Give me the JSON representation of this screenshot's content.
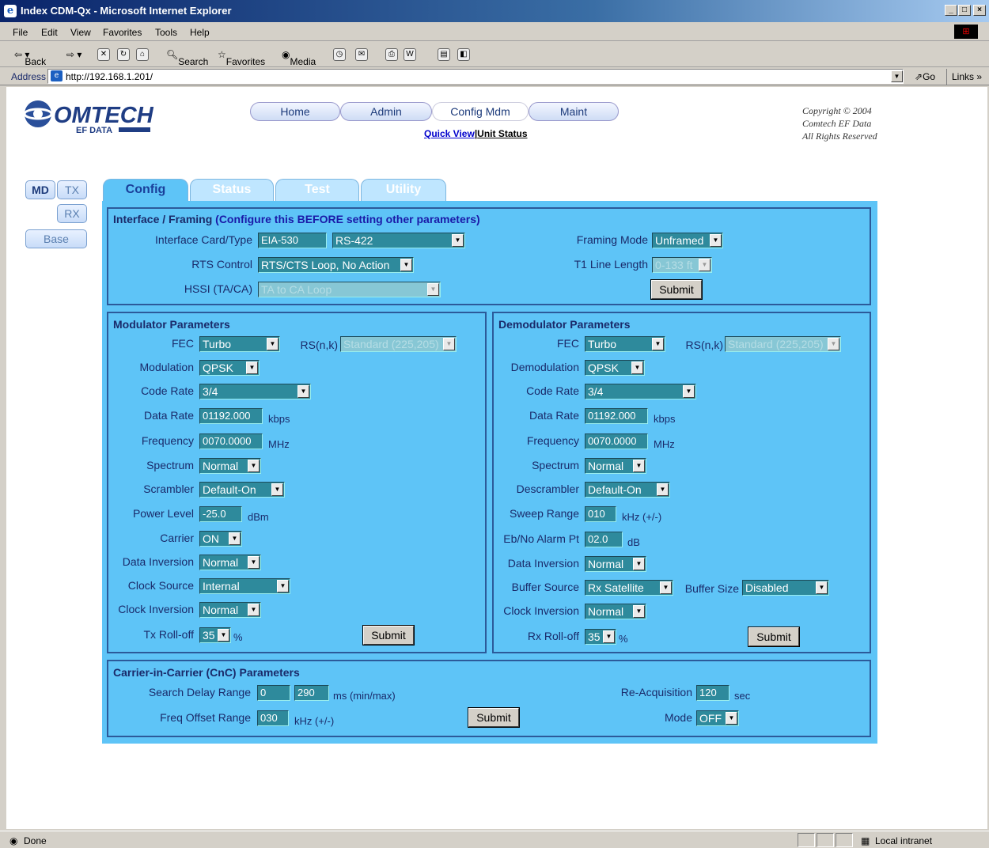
{
  "window": {
    "title": "Index CDM-Qx - Microsoft Internet Explorer"
  },
  "menu": [
    "File",
    "Edit",
    "View",
    "Favorites",
    "Tools",
    "Help"
  ],
  "toolbar": {
    "back": "Back",
    "search": "Search",
    "favorites": "Favorites",
    "media": "Media"
  },
  "address": {
    "label": "Address",
    "url": "http://192.168.1.201/",
    "go": "Go",
    "links": "Links »"
  },
  "header": {
    "nav": [
      "Home",
      "Admin",
      "Config Mdm",
      "Maint"
    ],
    "quick_view": "Quick View",
    "separator": "|",
    "unit_status": "Unit Status",
    "copyright": [
      "Copyright © 2004",
      "Comtech EF Data",
      "All Rights Reserved"
    ]
  },
  "side": {
    "md": "MD",
    "tx": "TX",
    "rx": "RX",
    "base": "Base"
  },
  "tabs": [
    "Config",
    "Status",
    "Test",
    "Utility"
  ],
  "interface": {
    "title": "Interface / Framing",
    "note": "(Configure this BEFORE setting other parameters)",
    "card_label": "Interface Card/Type",
    "card_value": "EIA-530",
    "type_value": "RS-422",
    "rts_label": "RTS Control",
    "rts_value": "RTS/CTS Loop, No Action",
    "hssi_label": "HSSI (TA/CA)",
    "hssi_value": "TA to CA Loop",
    "framing_label": "Framing Mode",
    "framing_value": "Unframed",
    "t1_label": "T1 Line Length",
    "t1_value": "0-133 ft",
    "submit": "Submit"
  },
  "mod": {
    "title": "Modulator Parameters",
    "fec_label": "FEC",
    "fec": "Turbo",
    "rs_label": "RS(n,k)",
    "rs": "Standard (225,205)",
    "modulation_label": "Modulation",
    "modulation": "QPSK",
    "code_rate_label": "Code Rate",
    "code_rate": "3/4",
    "data_rate_label": "Data Rate",
    "data_rate": "01192.000",
    "data_rate_unit": "kbps",
    "frequency_label": "Frequency",
    "frequency": "0070.0000",
    "frequency_unit": "MHz",
    "spectrum_label": "Spectrum",
    "spectrum": "Normal",
    "scrambler_label": "Scrambler",
    "scrambler": "Default-On",
    "power_label": "Power Level",
    "power": "-25.0",
    "power_unit": "dBm",
    "carrier_label": "Carrier",
    "carrier": "ON",
    "inversion_label": "Data Inversion",
    "inversion": "Normal",
    "clock_source_label": "Clock Source",
    "clock_source": "Internal",
    "clock_inversion_label": "Clock Inversion",
    "clock_inversion": "Normal",
    "rolloff_label": "Tx Roll-off",
    "rolloff": "35",
    "rolloff_unit": "%",
    "submit": "Submit"
  },
  "demod": {
    "title": "Demodulator Parameters",
    "fec_label": "FEC",
    "fec": "Turbo",
    "rs_label": "RS(n,k)",
    "rs": "Standard (225,205)",
    "demodulation_label": "Demodulation",
    "demodulation": "QPSK",
    "code_rate_label": "Code Rate",
    "code_rate": "3/4",
    "data_rate_label": "Data Rate",
    "data_rate": "01192.000",
    "data_rate_unit": "kbps",
    "frequency_label": "Frequency",
    "frequency": "0070.0000",
    "frequency_unit": "MHz",
    "spectrum_label": "Spectrum",
    "spectrum": "Normal",
    "descrambler_label": "Descrambler",
    "descrambler": "Default-On",
    "sweep_label": "Sweep Range",
    "sweep": "010",
    "sweep_unit": "kHz (+/-)",
    "ebno_label": "Eb/No Alarm Pt",
    "ebno": "02.0",
    "ebno_unit": "dB",
    "inversion_label": "Data Inversion",
    "inversion": "Normal",
    "buffer_source_label": "Buffer Source",
    "buffer_source": "Rx Satellite",
    "buffer_size_label": "Buffer Size",
    "buffer_size": "Disabled",
    "clock_inversion_label": "Clock Inversion",
    "clock_inversion": "Normal",
    "rolloff_label": "Rx Roll-off",
    "rolloff": "35",
    "rolloff_unit": "%",
    "submit": "Submit"
  },
  "cnc": {
    "title": "Carrier-in-Carrier (CnC) Parameters",
    "search_label": "Search Delay Range",
    "search_min": "0",
    "search_max": "290",
    "search_unit": "ms (min/max)",
    "freq_label": "Freq Offset Range",
    "freq": "030",
    "freq_unit": "kHz (+/-)",
    "reacq_label": "Re-Acquisition",
    "reacq": "120",
    "reacq_unit": "sec",
    "mode_label": "Mode",
    "mode": "OFF",
    "submit": "Submit"
  },
  "status": {
    "text": "Done",
    "zone": "Local intranet"
  }
}
